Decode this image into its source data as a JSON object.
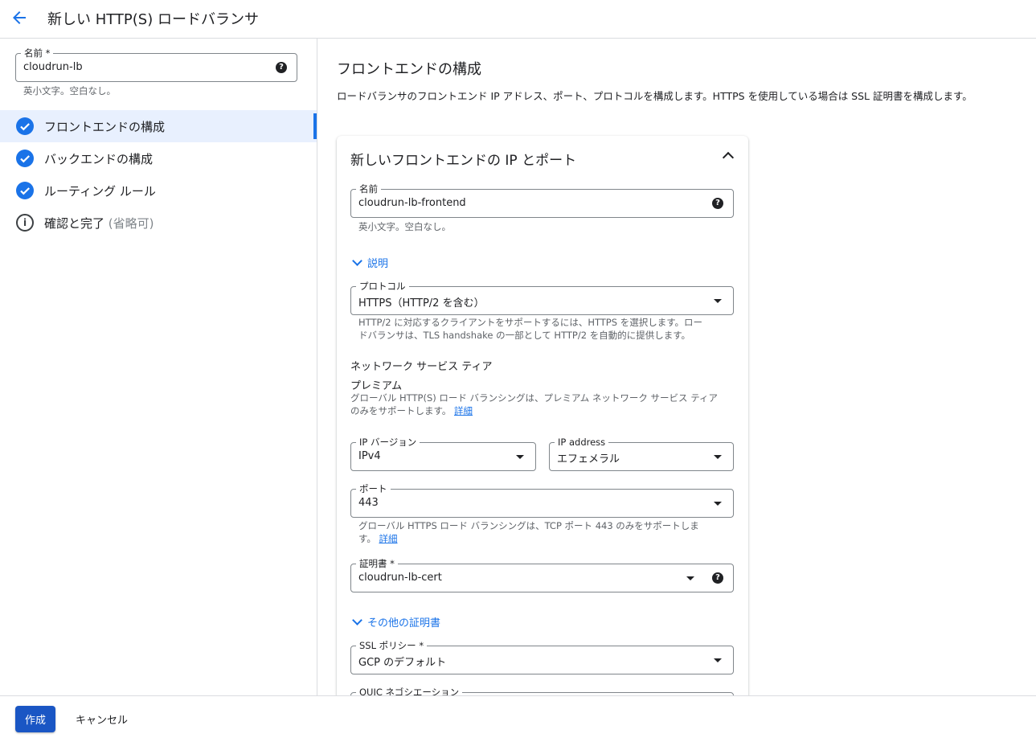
{
  "header": {
    "title": "新しい HTTP(S) ロードバランサ",
    "back_icon": "arrow-back-icon"
  },
  "sidebar": {
    "name_field": {
      "label": "名前 *",
      "value": "cloudrun-lb",
      "hint": "英小文字。空白なし。"
    },
    "steps": [
      {
        "label": "フロントエンドの構成",
        "status": "complete",
        "active": true
      },
      {
        "label": "バックエンドの構成",
        "status": "complete",
        "active": false
      },
      {
        "label": "ルーティング ルール",
        "status": "complete",
        "active": false
      },
      {
        "label": "確認と完了",
        "optional": "(省略可)",
        "status": "info",
        "active": false
      }
    ]
  },
  "main": {
    "title": "フロントエンドの構成",
    "description": "ロードバランサのフロントエンド IP アドレス、ポート、プロトコルを構成します。HTTPS を使用している場合は SSL 証明書を構成します。",
    "card": {
      "title": "新しいフロントエンドの IP とポート",
      "name": {
        "label": "名前",
        "value": "cloudrun-lb-frontend",
        "hint": "英小文字。空白なし。"
      },
      "description_toggle": "説明",
      "protocol": {
        "label": "プロトコル",
        "value": "HTTPS（HTTP/2 を含む）",
        "hint_line1": "HTTP/2 に対応するクライアントをサポートするには、HTTPS を選択します。ロー",
        "hint_line2": "ドバランサは、TLS handshake の一部として HTTP/2 を自動的に提供します。"
      },
      "network_tier": {
        "heading": "ネットワーク サービス ティア",
        "value": "プレミアム",
        "hint_line1": "グローバル HTTP(S) ロード バランシングは、プレミアム ネットワーク サービス ティア",
        "hint_line2": "のみをサポートします。",
        "link": "詳細"
      },
      "ip_version": {
        "label": "IP バージョン",
        "value": "IPv4"
      },
      "ip_address": {
        "label": "IP address",
        "value": "エフェメラル"
      },
      "port": {
        "label": "ポート",
        "value": "443",
        "hint_line1": "グローバル HTTPS ロード バランシングは、TCP ポート 443 のみをサポートしま",
        "hint_line2": "す。",
        "link": "詳細"
      },
      "certificate": {
        "label": "証明書 *",
        "value": "cloudrun-lb-cert"
      },
      "other_certs_toggle": "その他の証明書",
      "ssl_policy": {
        "label": "SSL ポリシー *",
        "value": "GCP のデフォルト"
      },
      "quic": {
        "label": "QUIC ネゴシエーション"
      }
    }
  },
  "footer": {
    "create_label": "作成",
    "cancel_label": "キャンセル"
  },
  "colors": {
    "accent": "#1a73e8",
    "primary_button": "#1a56c4",
    "active_step_bg": "#e8f0fe"
  }
}
